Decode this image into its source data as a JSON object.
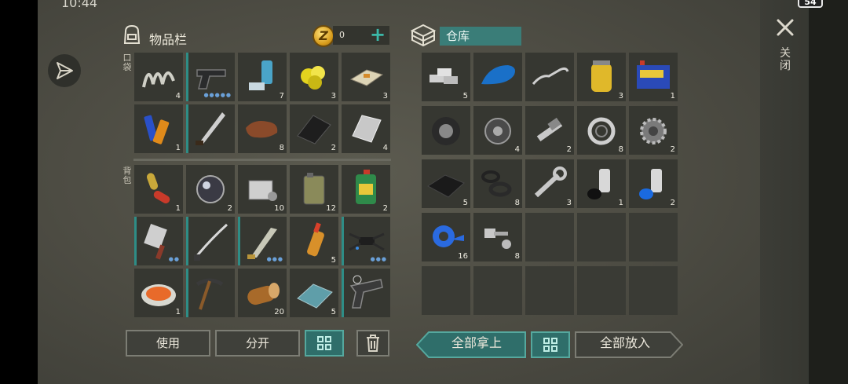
{
  "status": {
    "time": "10:44",
    "battery": "54"
  },
  "inventory": {
    "title": "物品栏",
    "coins": "0",
    "coin_symbol": "Z",
    "plus": "+",
    "pocket_label": "口袋",
    "backpack_label": "背包",
    "pocket_slots": [
      {
        "icon": "spring-icon",
        "count": "4"
      },
      {
        "icon": "pistol-icon",
        "count": "",
        "marked": true,
        "dots": "●●●●●"
      },
      {
        "icon": "inhaler-icon",
        "count": "7"
      },
      {
        "icon": "sulfur-icon",
        "count": "3"
      },
      {
        "icon": "soap-icon",
        "count": "3"
      },
      {
        "icon": "batteries-icon",
        "count": "1"
      },
      {
        "icon": "machete-icon",
        "count": "",
        "marked": true
      },
      {
        "icon": "leather-icon",
        "count": "8"
      },
      {
        "icon": "rubber-mat-icon",
        "count": "2"
      },
      {
        "icon": "metal-sheet-icon",
        "count": "4"
      }
    ],
    "backpack_slots": [
      {
        "icon": "pills-icon",
        "count": "1"
      },
      {
        "icon": "lens-icon",
        "count": "2"
      },
      {
        "icon": "engine-block-icon",
        "count": "10"
      },
      {
        "icon": "jerrycan-icon",
        "count": "12"
      },
      {
        "icon": "motor-oil-icon",
        "count": "2"
      },
      {
        "icon": "cleaver-icon",
        "count": "",
        "marked": true,
        "dots": "●●"
      },
      {
        "icon": "katana-icon",
        "count": "",
        "marked": true
      },
      {
        "icon": "machete2-icon",
        "count": "",
        "marked": true,
        "dots": "●●●"
      },
      {
        "icon": "bottle-icon",
        "count": "5"
      },
      {
        "icon": "drone-icon",
        "count": "",
        "marked": true,
        "dots": "●●●"
      },
      {
        "icon": "food-plate-icon",
        "count": "1"
      },
      {
        "icon": "pickaxe-icon",
        "count": "",
        "marked": true
      },
      {
        "icon": "log-icon",
        "count": "20"
      },
      {
        "icon": "glass-icon",
        "count": "5"
      },
      {
        "icon": "flare-gun-icon",
        "count": "",
        "marked": true
      }
    ]
  },
  "storage": {
    "name": "仓库",
    "slots": [
      {
        "icon": "silver-bars-icon",
        "count": "5"
      },
      {
        "icon": "fuel-tank-icon",
        "count": ""
      },
      {
        "icon": "handlebar-icon",
        "count": ""
      },
      {
        "icon": "oil-filter-icon",
        "count": "3"
      },
      {
        "icon": "car-battery-icon",
        "count": "1"
      },
      {
        "icon": "wheel-icon",
        "count": ""
      },
      {
        "icon": "pulley-icon",
        "count": "4"
      },
      {
        "icon": "spark-plug-icon",
        "count": "2"
      },
      {
        "icon": "bearing-icon",
        "count": "8"
      },
      {
        "icon": "gear-icon",
        "count": "2"
      },
      {
        "icon": "tarp-icon",
        "count": "5"
      },
      {
        "icon": "gaskets-icon",
        "count": "8"
      },
      {
        "icon": "wrench-icon",
        "count": "3"
      },
      {
        "icon": "spray-black-icon",
        "count": "1"
      },
      {
        "icon": "spray-blue-icon",
        "count": "2"
      },
      {
        "icon": "duct-tape-icon",
        "count": "16"
      },
      {
        "icon": "bolt-nut-icon",
        "count": "8"
      },
      {
        "icon": "",
        "count": ""
      },
      {
        "icon": "",
        "count": ""
      },
      {
        "icon": "",
        "count": ""
      },
      {
        "icon": "",
        "count": ""
      },
      {
        "icon": "",
        "count": ""
      },
      {
        "icon": "",
        "count": ""
      },
      {
        "icon": "",
        "count": ""
      },
      {
        "icon": "",
        "count": ""
      }
    ]
  },
  "buttons": {
    "use": "使用",
    "split": "分开",
    "take_all": "全部拿上",
    "put_all": "全部放入"
  },
  "close_label": "关闭"
}
